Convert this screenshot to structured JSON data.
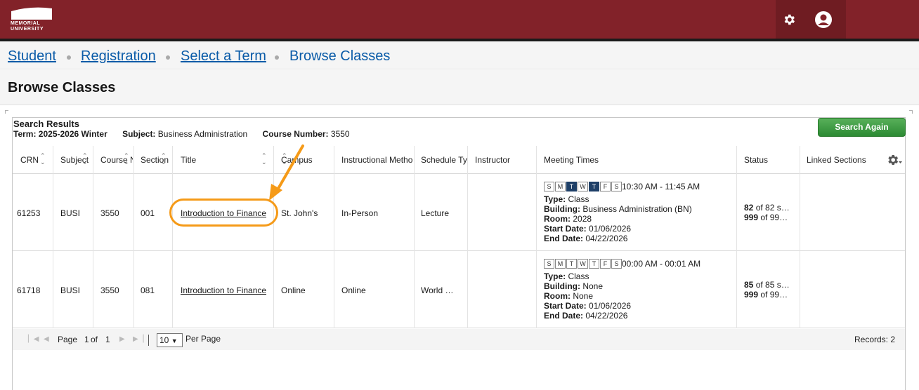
{
  "header": {
    "logo_alt": "MEMORIAL UNIVERSITY",
    "logo_line1": "MEMORIAL",
    "logo_line2": "UNIVERSITY",
    "icons": [
      "gear-icon",
      "user-icon"
    ],
    "brand_color": "#822229"
  },
  "breadcrumb": {
    "items": [
      {
        "label": "Student",
        "link": true
      },
      {
        "label": "Registration",
        "link": true
      },
      {
        "label": "Select a Term",
        "link": true
      },
      {
        "label": "Browse Classes",
        "link": false
      }
    ]
  },
  "page": {
    "title": "Browse Classes"
  },
  "results": {
    "heading": "Search Results",
    "term_label": "Term:",
    "term_value": "2025-2026 Winter",
    "subject_label": "Subject:",
    "subject_value": "Business Administration",
    "course_label": "Course Number:",
    "course_value": "3550",
    "search_again_label": "Search Again"
  },
  "table": {
    "columns": [
      "CRN",
      "Subject",
      "Course N",
      "Section",
      "Title",
      "Campus",
      "Instructional Metho",
      "Schedule Ty",
      "Instructor",
      "Meeting Times",
      "Status",
      "Linked Sections"
    ],
    "rows": [
      {
        "crn": "61253",
        "subject": "BUSI",
        "course": "3550",
        "section": "001",
        "title": "Introduction to Finance",
        "campus": "St. John's",
        "method": "In-Person",
        "schedule": "Lecture",
        "instructor": "",
        "days": [
          "S",
          "M",
          "T",
          "W",
          "T",
          "F",
          "S"
        ],
        "days_on": [
          false,
          false,
          true,
          false,
          true,
          false,
          false
        ],
        "time": "10:30 AM - 11:45 AM",
        "type_label": "Type:",
        "type_value": "Class",
        "building_label": "Building:",
        "building_value": "Business Administration (BN)",
        "room_label": "Room:",
        "room_value": "2028",
        "start_label": "Start Date:",
        "start_value": "01/06/2026",
        "end_label": "End Date:",
        "end_value": "04/22/2026",
        "status_seats": "82",
        "status_seats_rest": "of 82 s…",
        "status_wait": "999",
        "status_wait_rest": "of 99…",
        "linked": ""
      },
      {
        "crn": "61718",
        "subject": "BUSI",
        "course": "3550",
        "section": "081",
        "title": "Introduction to Finance",
        "campus": "Online",
        "method": "Online",
        "schedule": "World …",
        "instructor": "",
        "days": [
          "S",
          "M",
          "T",
          "W",
          "T",
          "F",
          "S"
        ],
        "days_on": [
          false,
          false,
          false,
          false,
          false,
          false,
          false
        ],
        "time": "00:00 AM - 00:01 AM",
        "type_label": "Type:",
        "type_value": "Class",
        "building_label": "Building:",
        "building_value": "None",
        "room_label": "Room:",
        "room_value": "None",
        "start_label": "Start Date:",
        "start_value": "01/06/2026",
        "end_label": "End Date:",
        "end_value": "04/22/2026",
        "status_seats": "85",
        "status_seats_rest": "of 85 s…",
        "status_wait": "999",
        "status_wait_rest": "of 99…",
        "linked": ""
      }
    ]
  },
  "pager": {
    "page_label": "Page",
    "page_current": "1",
    "of_label": "of",
    "page_total": "1",
    "per_page_value": "10",
    "per_page_label": "Per Page",
    "records": "Records: 2"
  },
  "annotation": {
    "highlight_color": "#f59a18"
  }
}
